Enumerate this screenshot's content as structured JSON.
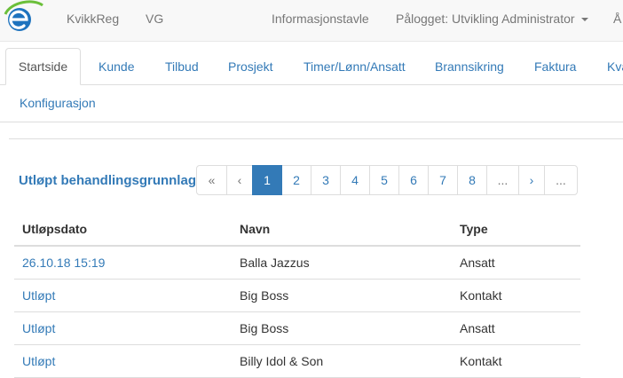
{
  "navbar": {
    "links": [
      "KvikkReg",
      "VG",
      "Informasjonstavle"
    ],
    "user_menu": "Pålogget: Utvikling Administrator",
    "overflow_link": "Å"
  },
  "tabs": [
    "Startside",
    "Kunde",
    "Tilbud",
    "Prosjekt",
    "Timer/Lønn/Ansatt",
    "Brannsikring",
    "Faktura",
    "Kva",
    "Konfigurasjon"
  ],
  "section_title": "Utløpt behandlingsgrunnlag",
  "pagination": {
    "items": [
      "«",
      "‹",
      "1",
      "2",
      "3",
      "4",
      "5",
      "6",
      "7",
      "8",
      "...",
      "›",
      "..."
    ],
    "active": "1"
  },
  "table": {
    "headers": [
      "Utløpsdato",
      "Navn",
      "Type"
    ],
    "rows": [
      [
        "26.10.18 15:19",
        "Balla Jazzus",
        "Ansatt"
      ],
      [
        "Utløpt",
        "Big Boss",
        "Kontakt"
      ],
      [
        "Utløpt",
        "Big Boss",
        "Ansatt"
      ],
      [
        "Utløpt",
        "Billy Idol & Son",
        "Kontakt"
      ]
    ]
  },
  "colors": {
    "link": "#337ab7",
    "active_page": "#337ab7",
    "logo_green": "#6bbf3a"
  },
  "icons": [
    "logo-e-icon",
    "caret-down-icon"
  ]
}
